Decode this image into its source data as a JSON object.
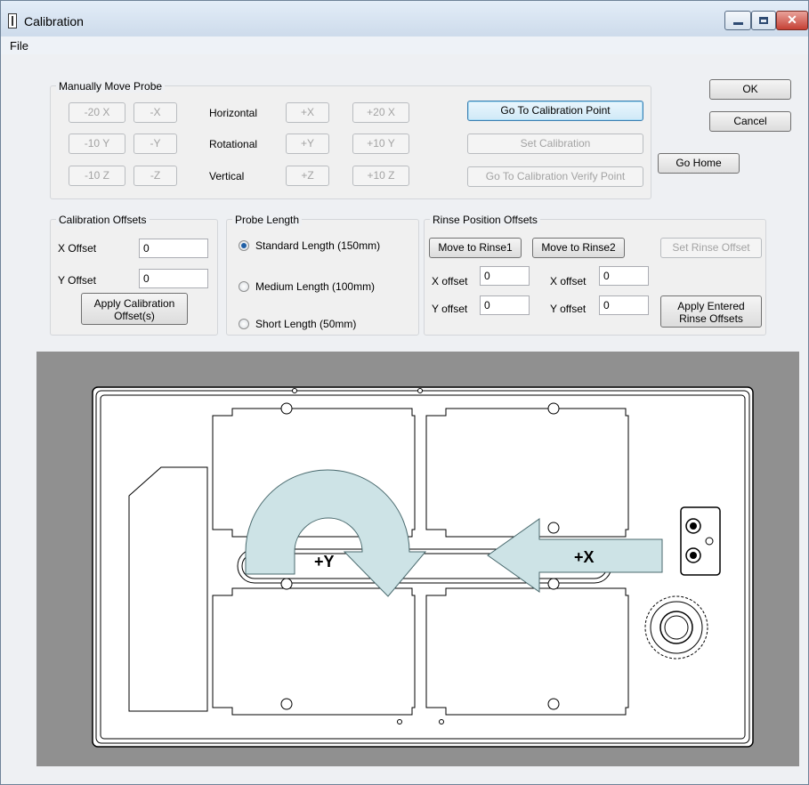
{
  "window": {
    "title": "Calibration"
  },
  "menu": {
    "file": "File"
  },
  "manual_move": {
    "legend": "Manually Move Probe",
    "row_labels": {
      "horizontal": "Horizontal",
      "rotational": "Rotational",
      "vertical": "Vertical"
    },
    "buttons": {
      "m20x": "-20 X",
      "mx": "-X",
      "px": "+X",
      "p20x": "+20 X",
      "m10y": "-10 Y",
      "my": "-Y",
      "py": "+Y",
      "p10y": "+10 Y",
      "m10z": "-10 Z",
      "mz": "-Z",
      "pz": "+Z",
      "p10z": "+10 Z"
    },
    "go_to_calibration_point": "Go To Calibration Point",
    "set_calibration": "Set Calibration",
    "go_to_verify_point": "Go To Calibration Verify Point"
  },
  "dialog_buttons": {
    "ok": "OK",
    "cancel": "Cancel",
    "go_home": "Go Home"
  },
  "calibration_offsets": {
    "legend": "Calibration Offsets",
    "x_label": "X Offset",
    "x_value": "0",
    "y_label": "Y Offset",
    "y_value": "0",
    "apply_line1": "Apply Calibration",
    "apply_line2": "Offset(s)"
  },
  "probe_length": {
    "legend": "Probe Length",
    "options": [
      "Standard Length (150mm)",
      "Medium Length (100mm)",
      "Short Length (50mm)"
    ],
    "selected": "Standard Length (150mm)"
  },
  "rinse_offsets": {
    "legend": "Rinse Position Offsets",
    "move_rinse1": "Move to Rinse1",
    "move_rinse2": "Move to Rinse2",
    "set_rinse_offset": "Set Rinse Offset",
    "x_offset_label": "X offset",
    "y_offset_label": "Y offset",
    "rinse1_x": "0",
    "rinse1_y": "0",
    "rinse2_x": "0",
    "rinse2_y": "0",
    "apply_line1": "Apply Entered",
    "apply_line2": "Rinse Offsets"
  },
  "diagram": {
    "y_arrow_label": "+Y",
    "x_arrow_label": "+X",
    "colors": {
      "background": "#909090",
      "plate": "#ffffff",
      "arrow_fill": "#cde3e6",
      "outline": "#000000"
    }
  }
}
